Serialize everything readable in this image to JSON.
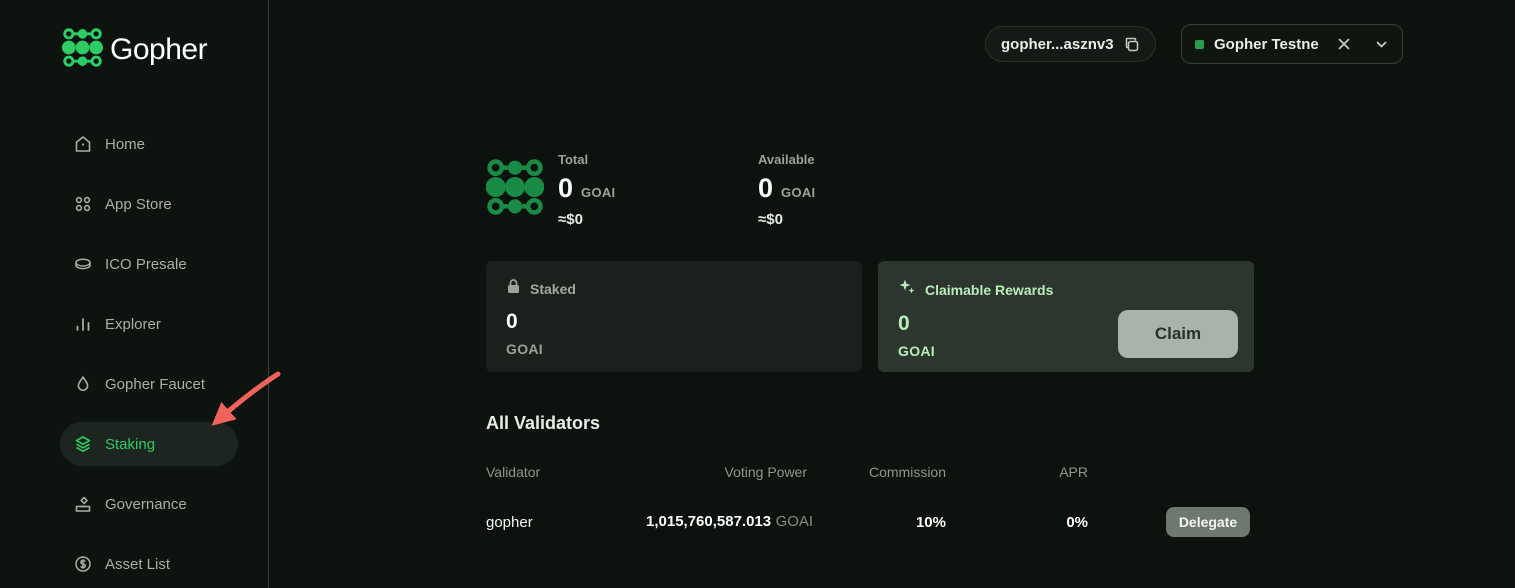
{
  "brand": {
    "name": "Gopher"
  },
  "header": {
    "wallet": {
      "address": "gopher...asznv3"
    },
    "network": {
      "label": "Gopher Testne"
    }
  },
  "sidebar": {
    "items": [
      {
        "label": "Home",
        "icon": "home-icon",
        "active": false
      },
      {
        "label": "App Store",
        "icon": "app-grid-icon",
        "active": false
      },
      {
        "label": "ICO Presale",
        "icon": "coin-icon",
        "active": false
      },
      {
        "label": "Explorer",
        "icon": "bar-chart-icon",
        "active": false
      },
      {
        "label": "Gopher Faucet",
        "icon": "droplet-icon",
        "active": false
      },
      {
        "label": "Staking",
        "icon": "layers-icon",
        "active": true
      },
      {
        "label": "Governance",
        "icon": "ballot-icon",
        "active": false
      },
      {
        "label": "Asset List",
        "icon": "dollar-coin-icon",
        "active": false
      }
    ]
  },
  "balances": {
    "total": {
      "label": "Total",
      "value": "0",
      "unit": "GOAI",
      "usd": "≈$0"
    },
    "available": {
      "label": "Available",
      "value": "0",
      "unit": "GOAI",
      "usd": "≈$0"
    }
  },
  "cards": {
    "staked": {
      "title": "Staked",
      "value": "0",
      "unit": "GOAI"
    },
    "rewards": {
      "title": "Claimable Rewards",
      "value": "0",
      "unit": "GOAI",
      "button_label": "Claim"
    }
  },
  "validators": {
    "heading": "All Validators",
    "columns": [
      "Validator",
      "Voting Power",
      "Commission",
      "APR"
    ],
    "rows": [
      {
        "validator": "gopher",
        "voting_power": "1,015,760,587.013",
        "unit": "GOAI",
        "commission": "10%",
        "apr": "0%",
        "action_label": "Delegate"
      }
    ]
  },
  "colors": {
    "background": "#0c120d",
    "accent_green": "#2ecc64",
    "dark_green": "#1a8a47",
    "pale_green": "#b9edba",
    "arrow_red": "#f2625d",
    "claim_button_bg": "#a9b3aa",
    "delegate_button_bg": "#6f786e"
  }
}
